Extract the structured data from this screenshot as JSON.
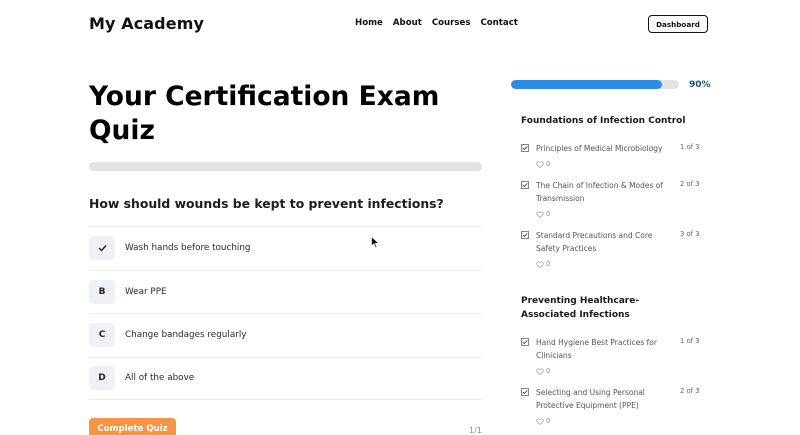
{
  "header": {
    "site_title": "My Academy",
    "nav": [
      "Home",
      "About",
      "Courses",
      "Contact"
    ],
    "dashboard_label": "Dashboard"
  },
  "quiz": {
    "title": "Your Certification Exam Quiz",
    "progress": 0,
    "question": "How should wounds be kept to prevent infections?",
    "answers": [
      {
        "badge": "✓",
        "text": "Wash hands before touching",
        "selected": true
      },
      {
        "badge": "B",
        "text": "Wear PPE",
        "selected": false
      },
      {
        "badge": "C",
        "text": "Change bandages regularly",
        "selected": false
      },
      {
        "badge": "D",
        "text": "All of the above",
        "selected": false
      }
    ],
    "complete_label": "Complete Quiz",
    "page_counter": "1/1"
  },
  "sidebar": {
    "progress_percent": 90,
    "progress_label": "90%",
    "colors": {
      "progress_fill": "#2b8de6",
      "complete_button": "#f59549"
    },
    "sections": [
      {
        "title": "Foundations of Infection Control",
        "lessons": [
          {
            "title": "Principles of Medical Microbiology",
            "count": "1 of 3",
            "likes": "0"
          },
          {
            "title": "The Chain of Infection & Modes of Transmission",
            "count": "2 of 3",
            "likes": "0"
          },
          {
            "title": "Standard Precautions and Core Safety Practices",
            "count": "3 of 3",
            "likes": "0"
          }
        ]
      },
      {
        "title": "Preventing Healthcare-Associated Infections",
        "lessons": [
          {
            "title": "Hand Hygiene Best Practices for Clinicians",
            "count": "1 of 3",
            "likes": "0"
          },
          {
            "title": "Selecting and Using Personal Protective Equipment (PPE)",
            "count": "2 of 3",
            "likes": "0"
          }
        ]
      }
    ]
  }
}
